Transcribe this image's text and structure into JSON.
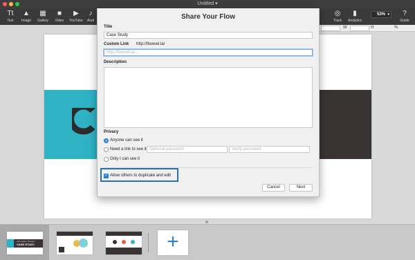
{
  "window": {
    "title": "Untitled ▾"
  },
  "toolbar": {
    "items": [
      {
        "label": "Text",
        "icon": "text-icon",
        "glyph": "Tt"
      },
      {
        "label": "Image",
        "icon": "image-icon",
        "glyph": "▲"
      },
      {
        "label": "Gallery",
        "icon": "gallery-icon",
        "glyph": "▦"
      },
      {
        "label": "Video",
        "icon": "video-icon",
        "glyph": "■"
      },
      {
        "label": "YouTube",
        "icon": "youtube-icon",
        "glyph": "▶"
      },
      {
        "label": "Audi",
        "icon": "audio-icon",
        "glyph": "♪"
      }
    ],
    "right_items": [
      {
        "label": "Track",
        "icon": "track-icon",
        "glyph": "◎"
      },
      {
        "label": "Analytics",
        "icon": "analytics-icon",
        "glyph": "▮"
      },
      {
        "label": "Guide",
        "icon": "guide-icon",
        "glyph": "?"
      }
    ],
    "zoom": "53%"
  },
  "inspector": {
    "w_label": "W",
    "h_label": "H",
    "pct_label": "%"
  },
  "modal": {
    "title": "Share Your Flow",
    "title_label": "Title",
    "title_value": "Case Study",
    "custom_link_label": "Custom Link",
    "custom_link_base": "http://flowvel.la/",
    "custom_link_placeholder": "http://flowvel.la/...",
    "description_label": "Description",
    "privacy_label": "Privacy",
    "privacy_options": [
      {
        "label": "Anyone can see it",
        "selected": true
      },
      {
        "label": "Need a link to see it",
        "selected": false
      },
      {
        "label": "Only I can see it",
        "selected": false
      }
    ],
    "optional_password_placeholder": "Optional password",
    "verify_password_placeholder": "Verify password",
    "allow_duplicate_label": "Allow others to duplicate and edit",
    "allow_duplicate_checked": true,
    "cancel_label": "Cancel",
    "next_label": "Next"
  },
  "filmstrip": {
    "thumb1_text": "CASE STUDY",
    "thumb1_sub": "Information Design |",
    "add_label": "+"
  },
  "colors": {
    "accent": "#2d7fe0",
    "teal": "#2fb2c3",
    "dark": "#3a3333",
    "highlight": "#2a6fb0"
  }
}
